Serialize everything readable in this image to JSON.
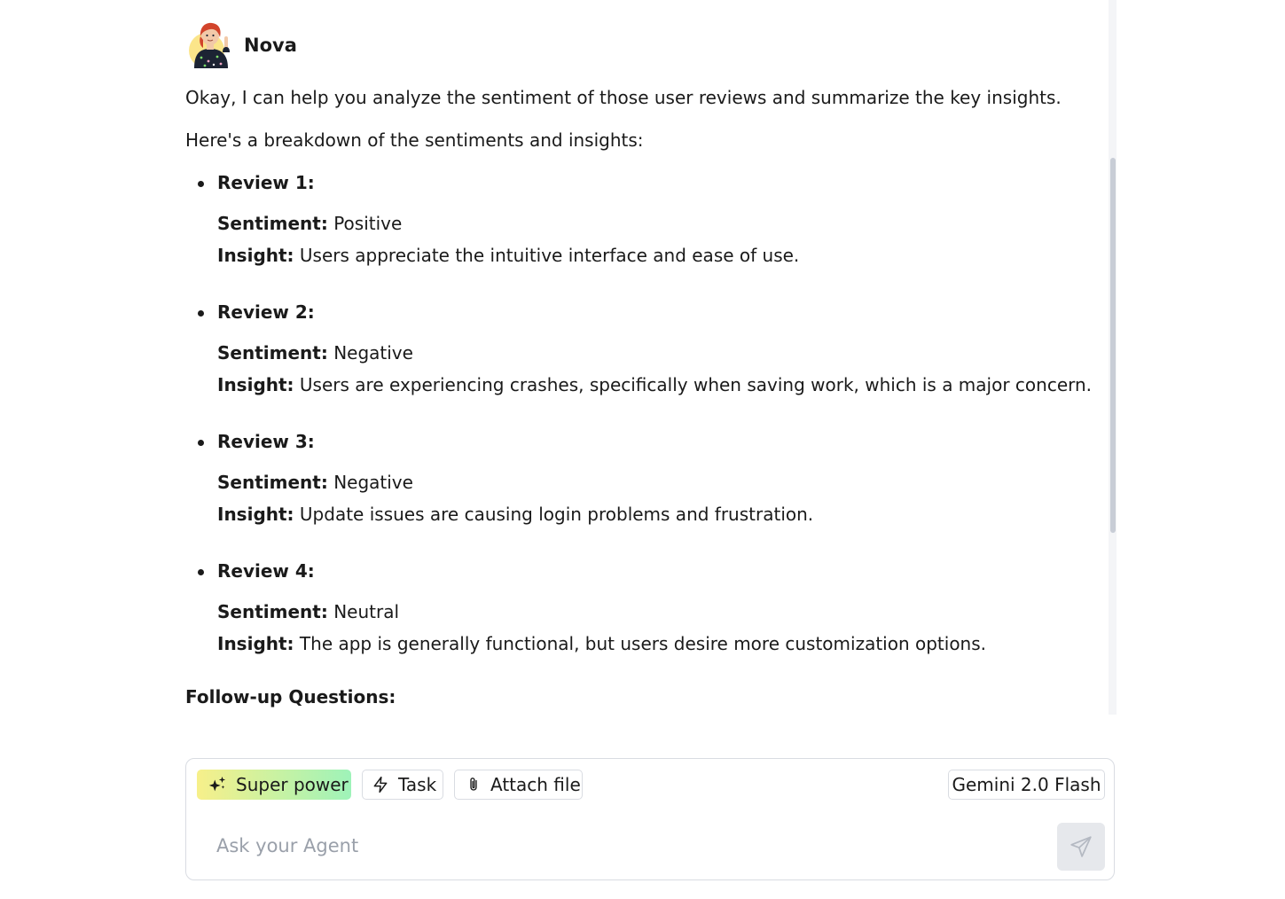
{
  "agent": {
    "name": "Nova",
    "avatar_icon": "avatar-illustration-icon"
  },
  "message": {
    "intro": "Okay, I can help you analyze the sentiment of those user reviews and summarize the key insights.",
    "breakdown_intro": "Here's a breakdown of the sentiments and insights:",
    "sentiment_label": "Sentiment:",
    "insight_label": "Insight:",
    "reviews": [
      {
        "title": "Review 1:",
        "sentiment": "Positive",
        "insight": "Users appreciate the intuitive interface and ease of use."
      },
      {
        "title": "Review 2:",
        "sentiment": "Negative",
        "insight": "Users are experiencing crashes, specifically when saving work, which is a major concern."
      },
      {
        "title": "Review 3:",
        "sentiment": "Negative",
        "insight": "Update issues are causing login problems and frustration."
      },
      {
        "title": "Review 4:",
        "sentiment": "Neutral",
        "insight": "The app is generally functional, but users desire more customization options."
      }
    ],
    "followup_heading": "Follow-up Questions:"
  },
  "composer": {
    "super_power_label": "Super power",
    "task_label": "Task",
    "attach_label": "Attach file",
    "model_label": "Gemini 2.0 Flash",
    "input_placeholder": "Ask your Agent",
    "input_value": ""
  },
  "colors": {
    "super_power_gradient_start": "#f7f08a",
    "super_power_gradient_end": "#9ef3b9",
    "send_button_bg": "#e6e8ec",
    "text": "#1a1a1a",
    "border": "#d9dce2"
  }
}
